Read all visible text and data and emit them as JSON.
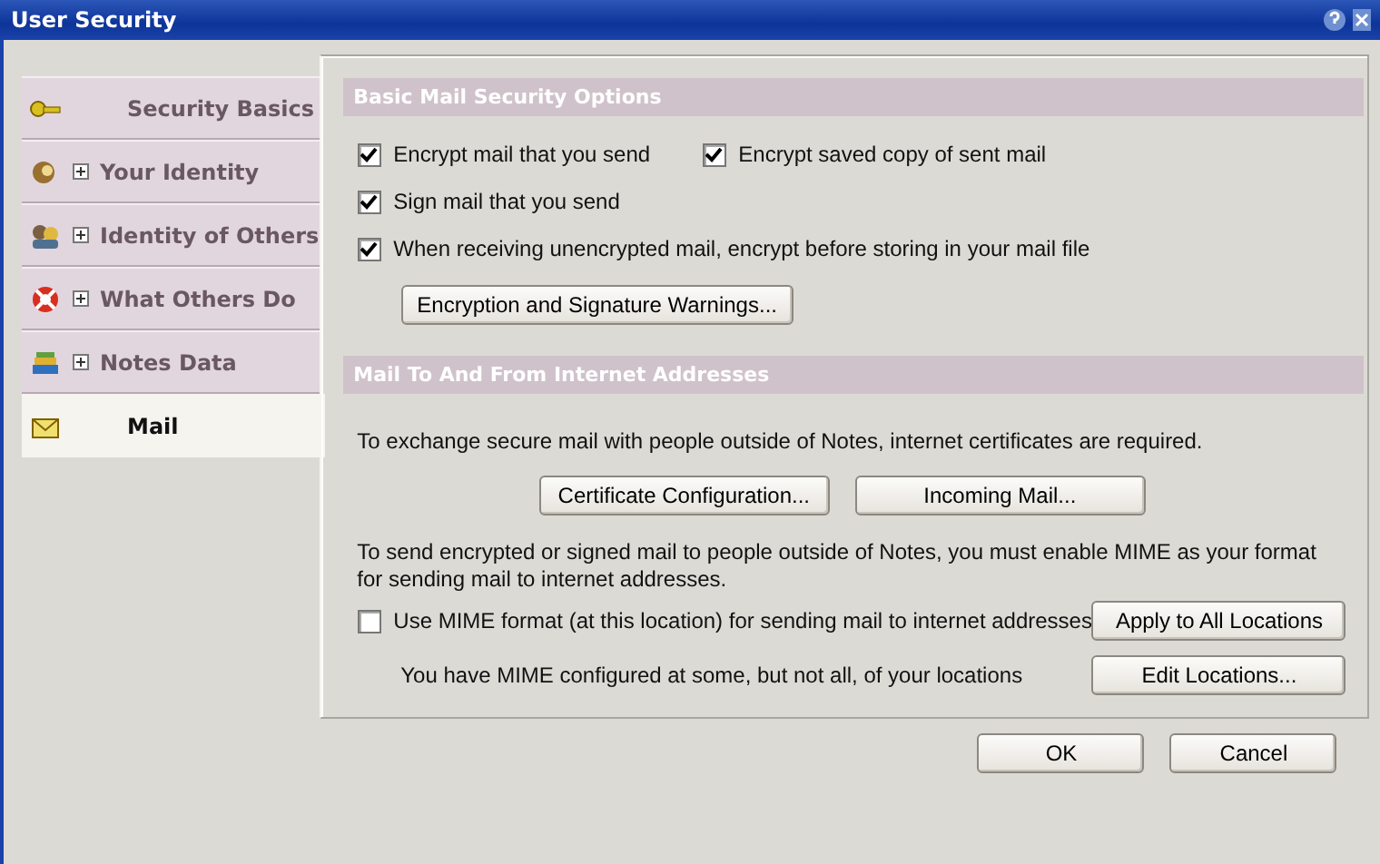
{
  "window": {
    "title": "User Security"
  },
  "sidebar": {
    "items": [
      {
        "label": "Security Basics",
        "expandable": false,
        "selected": false
      },
      {
        "label": "Your Identity",
        "expandable": true,
        "selected": false
      },
      {
        "label": "Identity of Others",
        "expandable": true,
        "selected": false
      },
      {
        "label": "What Others Do",
        "expandable": true,
        "selected": false
      },
      {
        "label": "Notes Data",
        "expandable": true,
        "selected": false
      },
      {
        "label": "Mail",
        "expandable": false,
        "selected": true
      }
    ]
  },
  "sections": [
    {
      "title": "Basic Mail Security Options",
      "rows": [
        {
          "kind": "checks",
          "checks": [
            {
              "label": "Encrypt mail that you send",
              "checked": true
            },
            {
              "label": "Encrypt saved copy of sent mail",
              "checked": true
            }
          ]
        },
        {
          "kind": "checks",
          "checks": [
            {
              "label": "Sign mail that you send",
              "checked": true
            }
          ]
        },
        {
          "kind": "checks",
          "checks": [
            {
              "label": "When receiving unencrypted mail, encrypt before storing in your mail file",
              "checked": true
            }
          ]
        },
        {
          "kind": "buttons",
          "buttons": [
            "Encryption and Signature Warnings..."
          ]
        }
      ]
    },
    {
      "title": "Mail To And From Internet Addresses",
      "rows": [
        {
          "kind": "text",
          "text": "To exchange secure mail with people outside of Notes, internet certificates are required."
        },
        {
          "kind": "buttons",
          "buttons": [
            "Certificate Configuration...",
            "Incoming Mail..."
          ]
        },
        {
          "kind": "text",
          "text": "To send encrypted or signed mail to people outside of Notes, you must enable MIME as your format for sending mail to internet addresses."
        },
        {
          "kind": "check-button",
          "check": {
            "label": "Use MIME format (at this location) for sending mail to internet addresses",
            "checked": false
          },
          "button": "Apply to All Locations"
        },
        {
          "kind": "text-button",
          "text": "You have MIME configured at some, but not all, of your locations",
          "button": "Edit Locations..."
        }
      ]
    }
  ],
  "footer": {
    "buttons": [
      "OK",
      "Cancel"
    ]
  }
}
